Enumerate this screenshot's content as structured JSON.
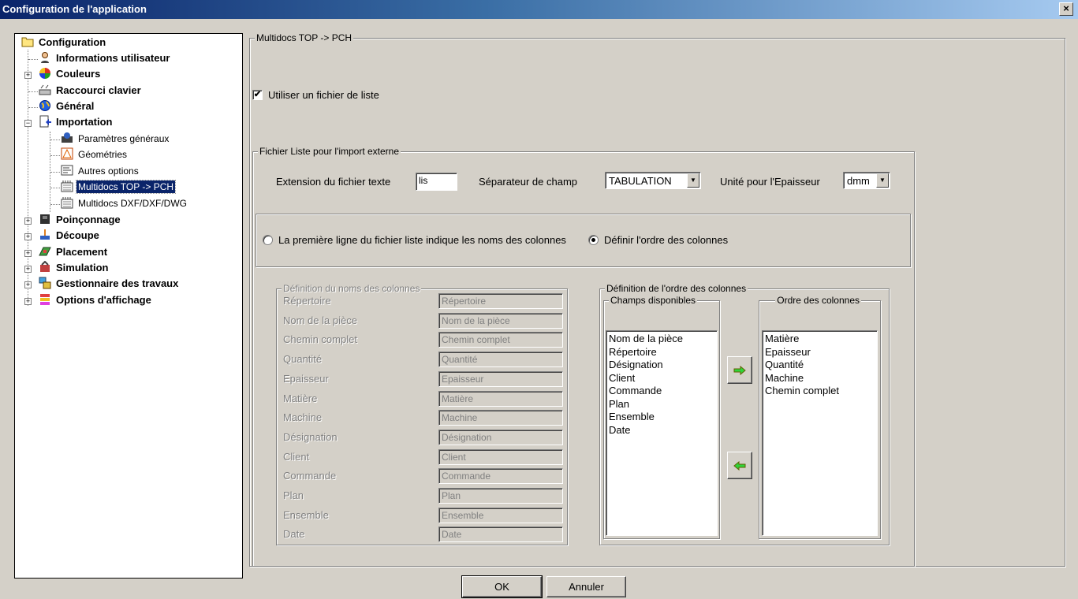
{
  "window": {
    "title": "Configuration de l'application",
    "close_label": "×"
  },
  "tree": {
    "root": "Configuration",
    "items": [
      {
        "label": "Informations utilisateur"
      },
      {
        "label": "Couleurs"
      },
      {
        "label": "Raccourci clavier"
      },
      {
        "label": "Général"
      },
      {
        "label": "Importation"
      },
      {
        "label": "Paramètres généraux"
      },
      {
        "label": "Géométries"
      },
      {
        "label": "Autres options"
      },
      {
        "label": "Multidocs TOP -> PCH"
      },
      {
        "label": "Multidocs DXF/DXF/DWG"
      },
      {
        "label": "Poinçonnage"
      },
      {
        "label": "Découpe"
      },
      {
        "label": "Placement"
      },
      {
        "label": "Simulation"
      },
      {
        "label": "Gestionnaire des travaux"
      },
      {
        "label": "Options d'affichage"
      }
    ],
    "selected": "Multidocs TOP -> PCH",
    "icons": [
      "folder-icon",
      "user-icon",
      "color-wheel-icon",
      "keyboard-icon",
      "globe-icon",
      "import-icon",
      "settings-icon",
      "geometry-icon",
      "options-icon",
      "multidocs-icon",
      "multidocs-icon",
      "punching-icon",
      "cutting-icon",
      "placement-icon",
      "simulation-icon",
      "job-manager-icon",
      "display-options-icon"
    ]
  },
  "main": {
    "group_title": "Multidocs TOP -> PCH",
    "use_list_file": {
      "label": "Utiliser un fichier de liste",
      "checked": true,
      "mark": "✔"
    },
    "list_file_group": {
      "title": "Fichier Liste pour l'import externe",
      "ext_label": "Extension du fichier texte",
      "ext_value": "lis",
      "sep_label": "Séparateur de champ",
      "sep_value": "TABULATION",
      "unit_label": "Unité pour l'Epaisseur",
      "unit_value": "dmm"
    },
    "radio_first_line": {
      "label": "La première ligne du fichier liste indique les noms des colonnes",
      "checked": false
    },
    "radio_define_order": {
      "label": "Définir l'ordre des colonnes",
      "checked": true
    },
    "col_names_group": {
      "title": "Définition du noms des colonnes",
      "rows": [
        {
          "label": "Répertoire",
          "value": "Répertoire"
        },
        {
          "label": "Nom de la pièce",
          "value": "Nom de la pièce"
        },
        {
          "label": "Chemin complet",
          "value": "Chemin complet"
        },
        {
          "label": "Quantité",
          "value": "Quantité"
        },
        {
          "label": "Epaisseur",
          "value": "Epaisseur"
        },
        {
          "label": "Matière",
          "value": "Matière"
        },
        {
          "label": "Machine",
          "value": "Machine"
        },
        {
          "label": "Désignation",
          "value": "Désignation"
        },
        {
          "label": "Client",
          "value": "Client"
        },
        {
          "label": "Commande",
          "value": "Commande"
        },
        {
          "label": "Plan",
          "value": "Plan"
        },
        {
          "label": "Ensemble",
          "value": "Ensemble"
        },
        {
          "label": "Date",
          "value": "Date"
        }
      ]
    },
    "col_order_group": {
      "title": "Définition de l'ordre des colonnes",
      "available_title": "Champs disponibles",
      "available": [
        "Nom de la pièce",
        "Répertoire",
        "Désignation",
        "Client",
        "Commande",
        "Plan",
        "Ensemble",
        "Date"
      ],
      "order_title": "Ordre des colonnes",
      "order": [
        "Matière",
        "Epaisseur",
        "Quantité",
        "Machine",
        "Chemin complet"
      ]
    }
  },
  "buttons": {
    "ok": "OK",
    "cancel": "Annuler"
  },
  "colors": {
    "arrow_green": "#2fd43a",
    "selection": "#0a246a"
  }
}
